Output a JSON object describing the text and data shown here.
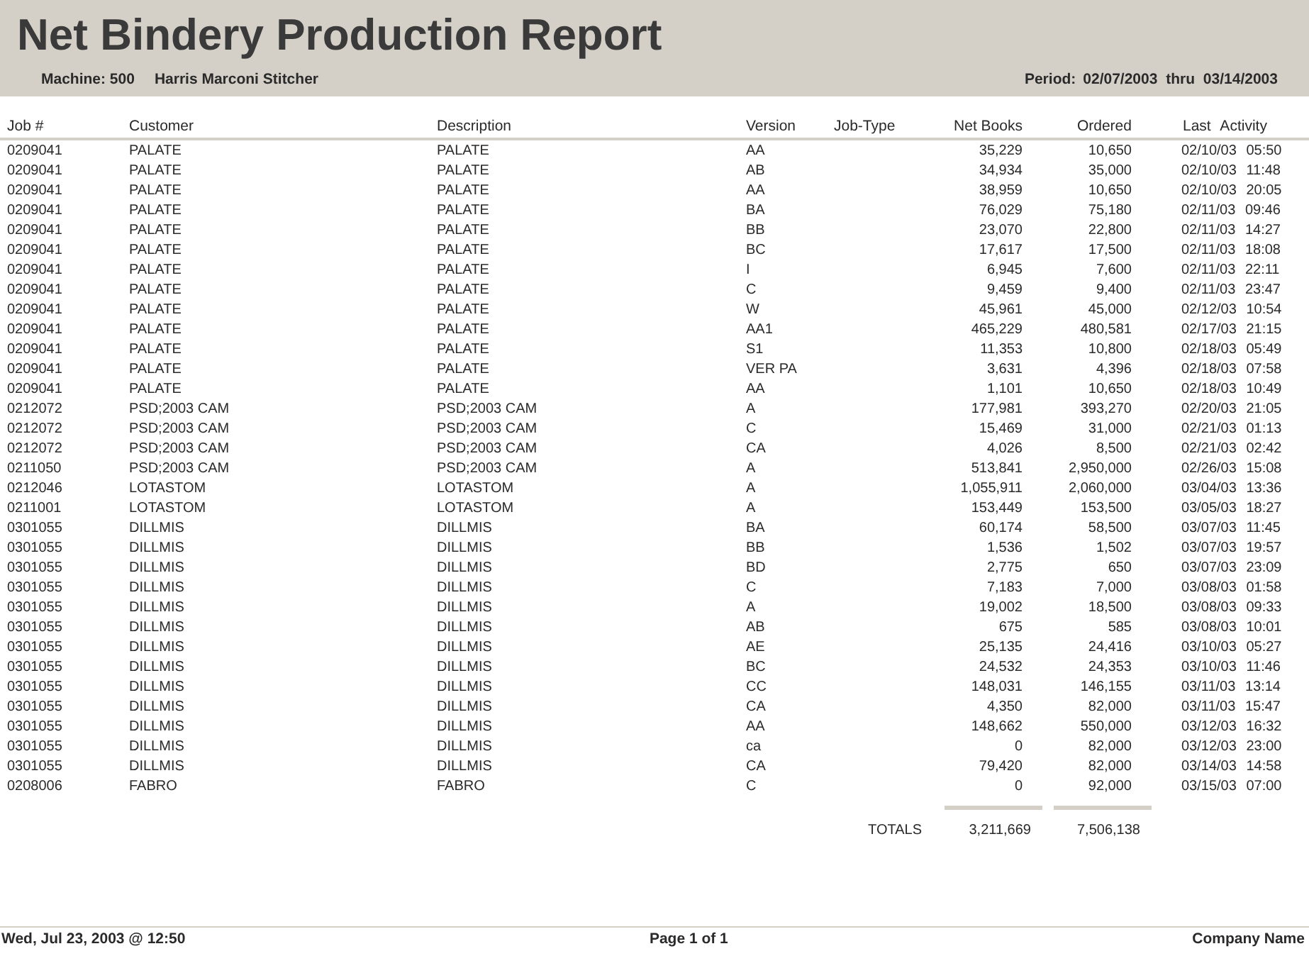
{
  "report": {
    "title": "Net Bindery Production Report",
    "machine": "Machine: 500",
    "machine_name": "Harris Marconi Stitcher",
    "period_label": "Period:",
    "period": "02/07/2003 thru 03/14/2003"
  },
  "table": {
    "columns": [
      "Job #",
      "Customer",
      "Description",
      "Version",
      "Job-Type",
      "Net Books",
      "Ordered",
      "Last Activity"
    ],
    "rows": [
      {
        "job": "0209041",
        "customer": "PALATE",
        "description": "PALATE",
        "version": "AA",
        "net_books": "35,229",
        "ordered": "10,650",
        "last_activity": "02/10/03 05:50"
      },
      {
        "job": "0209041",
        "customer": "PALATE",
        "description": "PALATE",
        "version": "AB",
        "net_books": "34,934",
        "ordered": "35,000",
        "last_activity": "02/10/03 11:48"
      },
      {
        "job": "0209041",
        "customer": "PALATE",
        "description": "PALATE",
        "version": "AA",
        "net_books": "38,959",
        "ordered": "10,650",
        "last_activity": "02/10/03 20:05"
      },
      {
        "job": "0209041",
        "customer": "PALATE",
        "description": "PALATE",
        "version": "BA",
        "net_books": "76,029",
        "ordered": "75,180",
        "last_activity": "02/11/03 09:46"
      },
      {
        "job": "0209041",
        "customer": "PALATE",
        "description": "PALATE",
        "version": "BB",
        "net_books": "23,070",
        "ordered": "22,800",
        "last_activity": "02/11/03 14:27"
      },
      {
        "job": "0209041",
        "customer": "PALATE",
        "description": "PALATE",
        "version": "BC",
        "net_books": "17,617",
        "ordered": "17,500",
        "last_activity": "02/11/03 18:08"
      },
      {
        "job": "0209041",
        "customer": "PALATE",
        "description": "PALATE",
        "version": "I",
        "net_books": "6,945",
        "ordered": "7,600",
        "last_activity": "02/11/03 22:11"
      },
      {
        "job": "0209041",
        "customer": "PALATE",
        "description": "PALATE",
        "version": "C",
        "net_books": "9,459",
        "ordered": "9,400",
        "last_activity": "02/11/03 23:47"
      },
      {
        "job": "0209041",
        "customer": "PALATE",
        "description": "PALATE",
        "version": "W",
        "net_books": "45,961",
        "ordered": "45,000",
        "last_activity": "02/12/03 10:54"
      },
      {
        "job": "0209041",
        "customer": "PALATE",
        "description": "PALATE",
        "version": "AA1",
        "net_books": "465,229",
        "ordered": "480,581",
        "last_activity": "02/17/03 21:15"
      },
      {
        "job": "0209041",
        "customer": "PALATE",
        "description": "PALATE",
        "version": "S1",
        "net_books": "11,353",
        "ordered": "10,800",
        "last_activity": "02/18/03 05:49"
      },
      {
        "job": "0209041",
        "customer": "PALATE",
        "description": "PALATE",
        "version": "VER PA",
        "net_books": "3,631",
        "ordered": "4,396",
        "last_activity": "02/18/03 07:58"
      },
      {
        "job": "0209041",
        "customer": "PALATE",
        "description": "PALATE",
        "version": "AA",
        "net_books": "1,101",
        "ordered": "10,650",
        "last_activity": "02/18/03 10:49"
      },
      {
        "job": "0212072",
        "customer": "PSD;2003 CAM",
        "description": "PSD;2003 CAM",
        "version": "A",
        "net_books": "177,981",
        "ordered": "393,270",
        "last_activity": "02/20/03 21:05"
      },
      {
        "job": "0212072",
        "customer": "PSD;2003 CAM",
        "description": "PSD;2003 CAM",
        "version": "C",
        "net_books": "15,469",
        "ordered": "31,000",
        "last_activity": "02/21/03 01:13"
      },
      {
        "job": "0212072",
        "customer": "PSD;2003 CAM",
        "description": "PSD;2003 CAM",
        "version": "CA",
        "net_books": "4,026",
        "ordered": "8,500",
        "last_activity": "02/21/03 02:42"
      },
      {
        "job": "0211050",
        "customer": "PSD;2003 CAM",
        "description": "PSD;2003 CAM",
        "version": "A",
        "net_books": "513,841",
        "ordered": "2,950,000",
        "last_activity": "02/26/03 15:08"
      },
      {
        "job": "0212046",
        "customer": "LOTASTOM",
        "description": "LOTASTOM",
        "version": "A",
        "net_books": "1,055,911",
        "ordered": "2,060,000",
        "last_activity": "03/04/03 13:36"
      },
      {
        "job": "0211001",
        "customer": "LOTASTOM",
        "description": "LOTASTOM",
        "version": "A",
        "net_books": "153,449",
        "ordered": "153,500",
        "last_activity": "03/05/03 18:27"
      },
      {
        "job": "0301055",
        "customer": "DILLMIS",
        "description": "DILLMIS",
        "version": "BA",
        "net_books": "60,174",
        "ordered": "58,500",
        "last_activity": "03/07/03 11:45"
      },
      {
        "job": "0301055",
        "customer": "DILLMIS",
        "description": "DILLMIS",
        "version": "BB",
        "net_books": "1,536",
        "ordered": "1,502",
        "last_activity": "03/07/03 19:57"
      },
      {
        "job": "0301055",
        "customer": "DILLMIS",
        "description": "DILLMIS",
        "version": "BD",
        "net_books": "2,775",
        "ordered": "650",
        "last_activity": "03/07/03 23:09"
      },
      {
        "job": "0301055",
        "customer": "DILLMIS",
        "description": "DILLMIS",
        "version": "C",
        "net_books": "7,183",
        "ordered": "7,000",
        "last_activity": "03/08/03 01:58"
      },
      {
        "job": "0301055",
        "customer": "DILLMIS",
        "description": "DILLMIS",
        "version": "A",
        "net_books": "19,002",
        "ordered": "18,500",
        "last_activity": "03/08/03 09:33"
      },
      {
        "job": "0301055",
        "customer": "DILLMIS",
        "description": "DILLMIS",
        "version": "AB",
        "net_books": "675",
        "ordered": "585",
        "last_activity": "03/08/03 10:01"
      },
      {
        "job": "0301055",
        "customer": "DILLMIS",
        "description": "DILLMIS",
        "version": "AE",
        "net_books": "25,135",
        "ordered": "24,416",
        "last_activity": "03/10/03 05:27"
      },
      {
        "job": "0301055",
        "customer": "DILLMIS",
        "description": "DILLMIS",
        "version": "BC",
        "net_books": "24,532",
        "ordered": "24,353",
        "last_activity": "03/10/03 11:46"
      },
      {
        "job": "0301055",
        "customer": "DILLMIS",
        "description": "DILLMIS",
        "version": "CC",
        "net_books": "148,031",
        "ordered": "146,155",
        "last_activity": "03/11/03 13:14"
      },
      {
        "job": "0301055",
        "customer": "DILLMIS",
        "description": "DILLMIS",
        "version": "CA",
        "net_books": "4,350",
        "ordered": "82,000",
        "last_activity": "03/11/03 15:47"
      },
      {
        "job": "0301055",
        "customer": "DILLMIS",
        "description": "DILLMIS",
        "version": "AA",
        "net_books": "148,662",
        "ordered": "550,000",
        "last_activity": "03/12/03 16:32"
      },
      {
        "job": "0301055",
        "customer": "DILLMIS",
        "description": "DILLMIS",
        "version": "ca",
        "net_books": "0",
        "ordered": "82,000",
        "last_activity": "03/12/03 23:00"
      },
      {
        "job": "0301055",
        "customer": "DILLMIS",
        "description": "DILLMIS",
        "version": "CA",
        "net_books": "79,420",
        "ordered": "82,000",
        "last_activity": "03/14/03 14:58"
      },
      {
        "job": "0208006",
        "customer": "FABRO",
        "description": "FABRO",
        "version": "C",
        "net_books": "0",
        "ordered": "92,000",
        "last_activity": "03/15/03 07:00"
      }
    ],
    "totals": {
      "label": "TOTALS",
      "net_books": "3,211,669",
      "ordered": "7,506,138"
    }
  },
  "footer": {
    "printed": "Wed, Jul 23, 2003 @ 12:50",
    "page": "Page 1 of 1",
    "company": "Company Name"
  }
}
